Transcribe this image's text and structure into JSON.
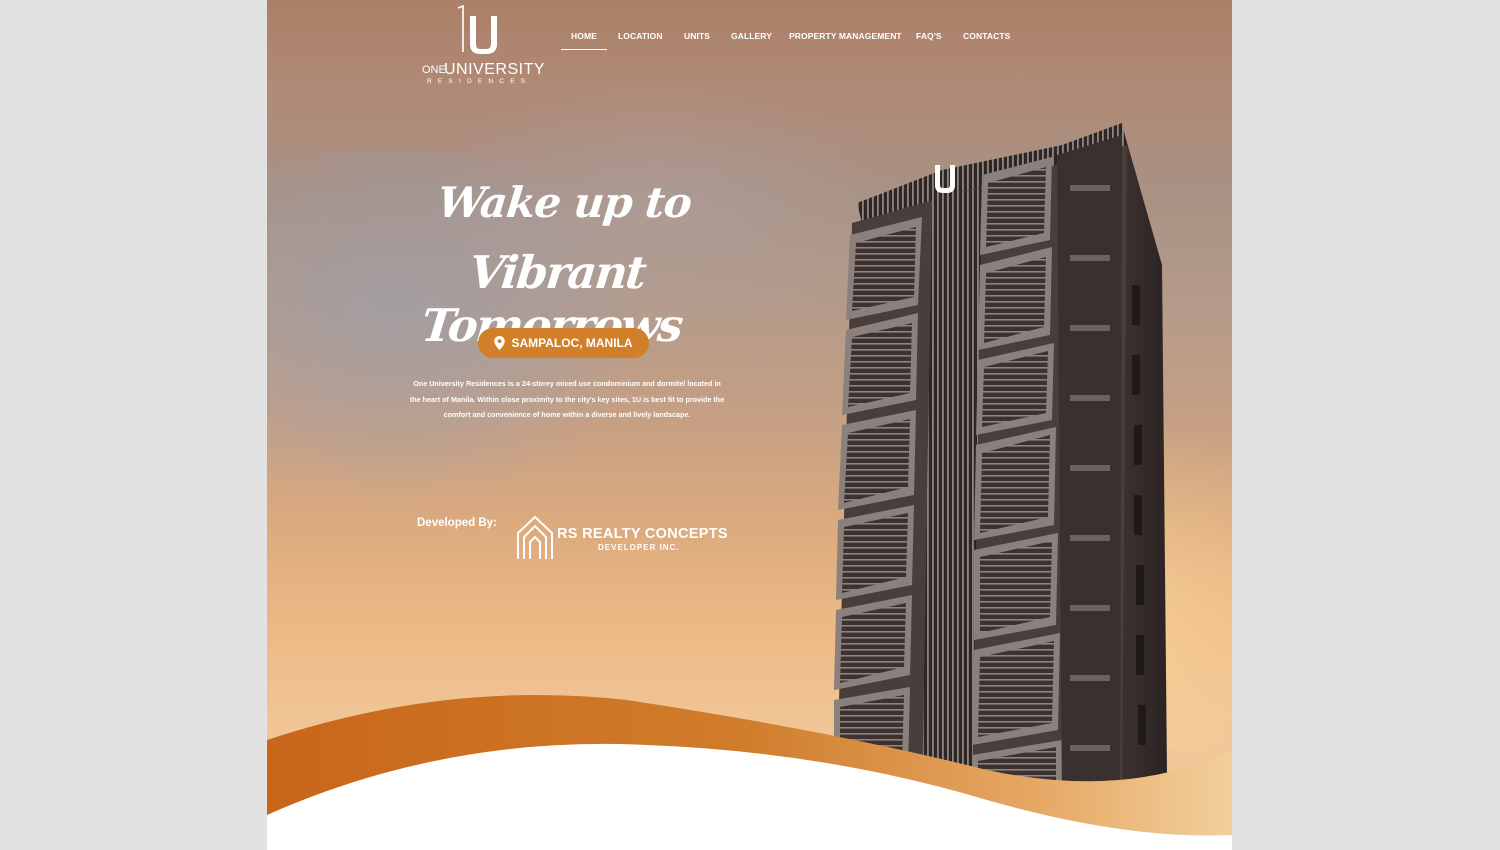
{
  "brand": {
    "logo_mark": "U",
    "logo_one": "ONE",
    "logo_university": "UNIVERSITY",
    "logo_residences": "RESIDENCES"
  },
  "nav": {
    "items": [
      "HOME",
      "LOCATION",
      "UNITS",
      "GALLERY",
      "PROPERTY MANAGEMENT",
      "FAQ'S",
      "CONTACTS"
    ],
    "active": "HOME"
  },
  "hero": {
    "headline_line1": "Wake up to",
    "headline_line2": "Vibrant Tomorrows",
    "location": "SAMPALOC, MANILA",
    "description": "One University Residences is a 24-storey mixed use condominium and dormitel located in the heart of Manila. Within close proximity to the city's key sites, 1U is best fit to provide the comfort and convenience of home within a diverse and lively landscape."
  },
  "developer": {
    "label": "Developed By:",
    "name": "RS REALTY CONCEPTS",
    "sub": "DEVELOPER INC."
  },
  "colors": {
    "accent": "#d27f2a",
    "wave_dark": "#c8661a",
    "wave_light": "#eec48f",
    "tower": "#4a3e3c"
  },
  "icons": [
    "location-pin-icon",
    "rs-house-logo-icon",
    "one-u-logo-icon"
  ]
}
